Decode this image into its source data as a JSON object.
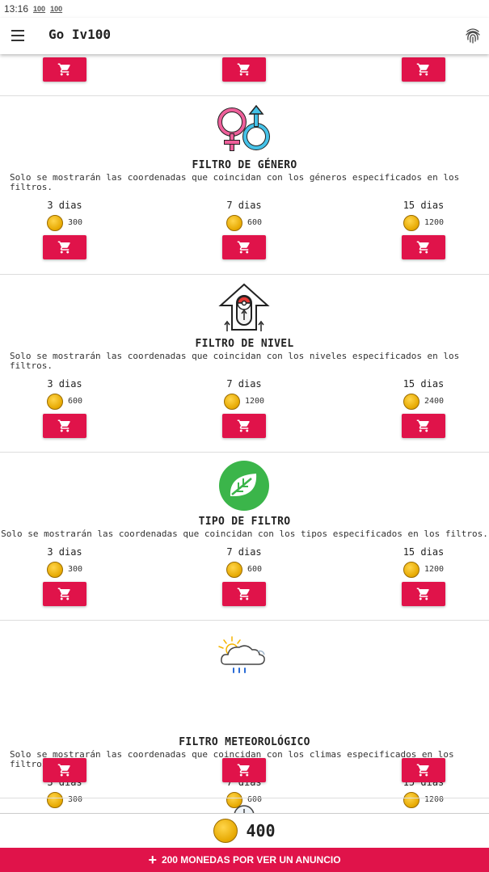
{
  "status": {
    "time": "13:16",
    "badges": [
      "100",
      "100"
    ]
  },
  "appbar": {
    "title": "Go Iv100",
    "menu_icon": "menu-icon",
    "action_icon": "fingerprint-icon"
  },
  "sections": [
    {
      "id": "gender",
      "icon": "gender-symbols-icon",
      "title": "FILTRO DE GÉNERO",
      "desc": "Solo se mostrarán las coordenadas que coincidan con los géneros especificados en los filtros.",
      "options": [
        {
          "days": "3 dias",
          "price": "300"
        },
        {
          "days": "7 dias",
          "price": "600"
        },
        {
          "days": "15 dias",
          "price": "1200"
        }
      ]
    },
    {
      "id": "level",
      "icon": "level-up-icon",
      "title": "FILTRO DE NIVEL",
      "desc": "Solo se mostrarán las coordenadas que coincidan con los niveles especificados en los filtros.",
      "options": [
        {
          "days": "3 dias",
          "price": "600"
        },
        {
          "days": "7 dias",
          "price": "1200"
        },
        {
          "days": "15 dias",
          "price": "2400"
        }
      ]
    },
    {
      "id": "type",
      "icon": "leaf-type-icon",
      "title": "TIPO DE FILTRO",
      "desc": "Solo se mostrarán las coordenadas que coincidan con los tipos especificados en los filtros.",
      "options": [
        {
          "days": "3 dias",
          "price": "300"
        },
        {
          "days": "7 dias",
          "price": "600"
        },
        {
          "days": "15 dias",
          "price": "1200"
        }
      ]
    },
    {
      "id": "weather",
      "icon": "weather-cloud-icon",
      "title": "FILTRO METEOROLÓGICO",
      "desc": "Solo se mostrarán las coordenadas que coincidan con los climas especificados en los filtros.",
      "options": [
        {
          "days": "3 dias",
          "price": "300"
        },
        {
          "days": "7 dias",
          "price": "600"
        },
        {
          "days": "15 dias",
          "price": "1200"
        }
      ]
    }
  ],
  "balance": {
    "amount": "400",
    "icon": "coin-icon"
  },
  "ad_button": {
    "label": "200 MONEDAS POR VER UN ANUNCIO",
    "icon": "plus-icon"
  },
  "colors": {
    "accent": "#e0134a",
    "coin": "#e6a800",
    "leaf_green": "#3bb54a"
  }
}
